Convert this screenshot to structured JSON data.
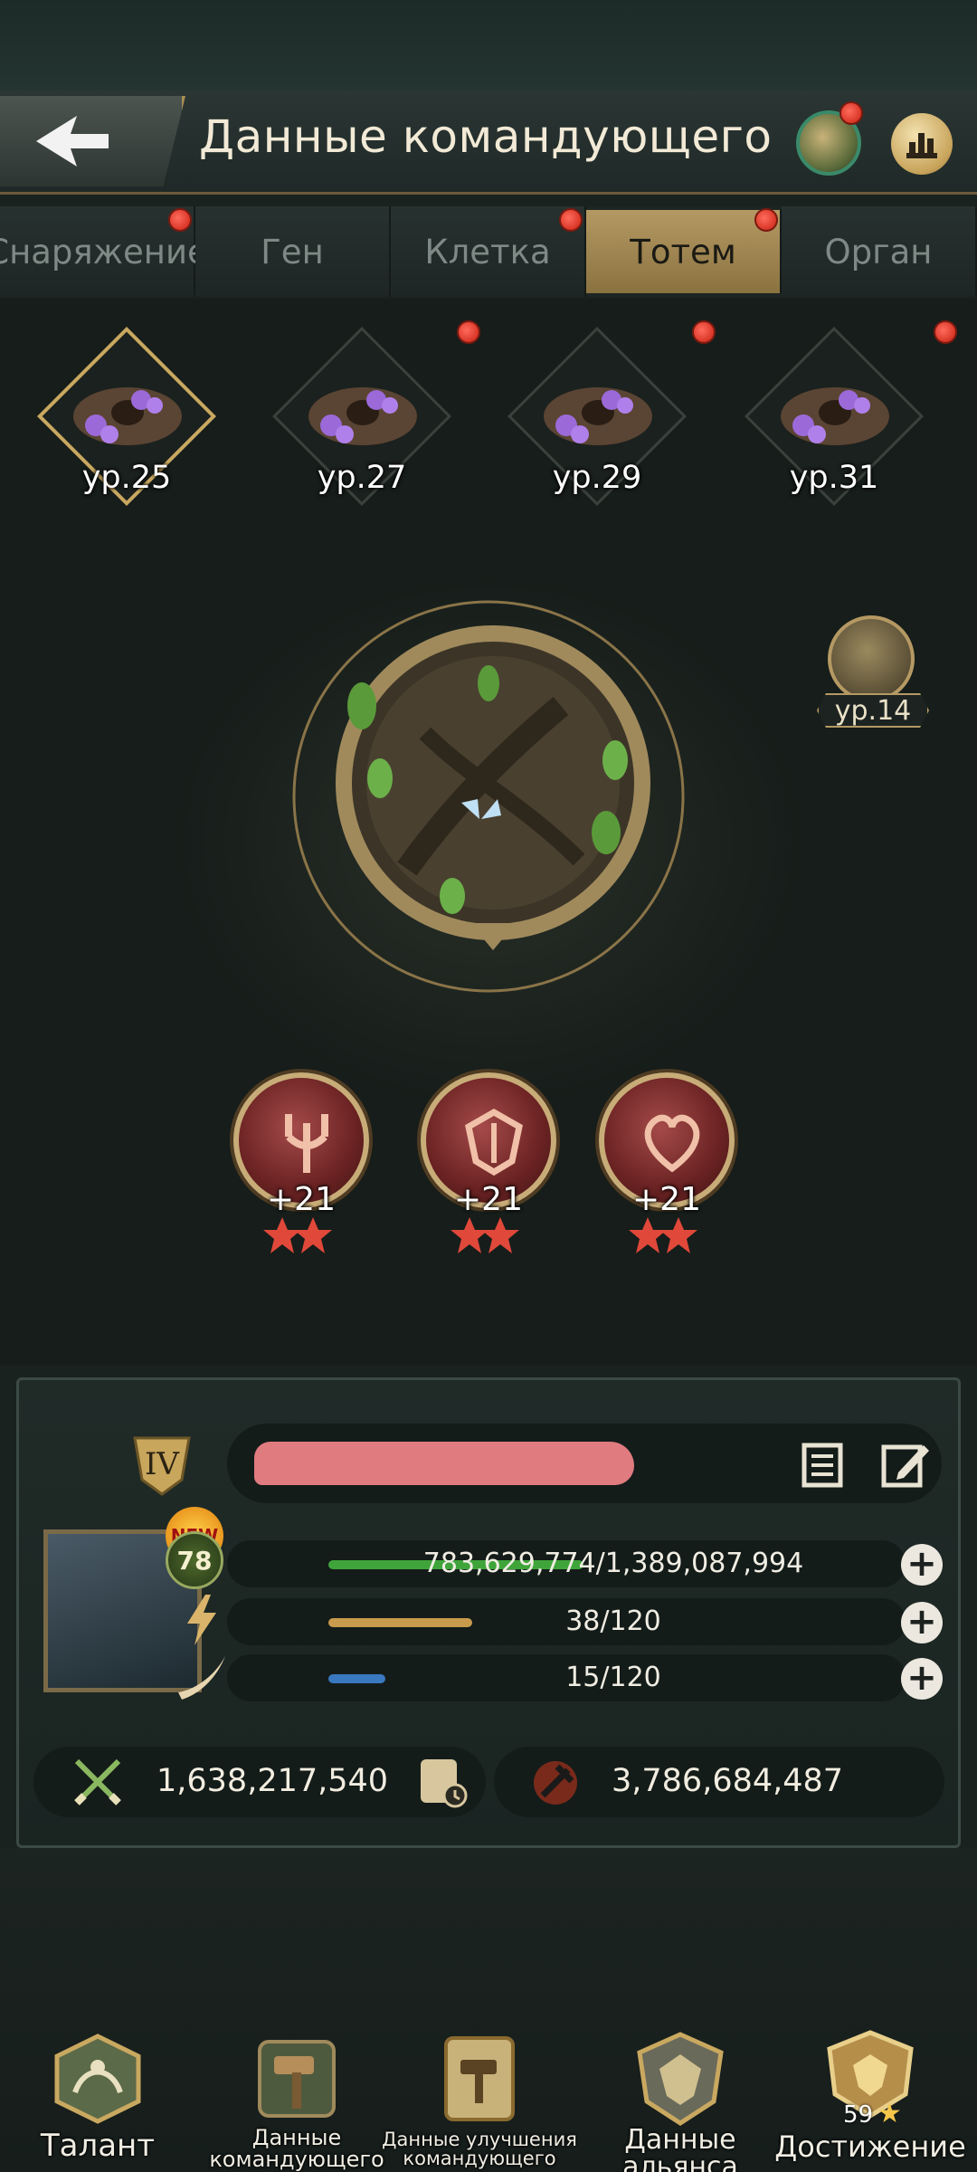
{
  "header": {
    "title": "Данные командующего",
    "back_icon": "back-arrow-icon",
    "icons": [
      "totem-shop-icon",
      "ranking-icon"
    ]
  },
  "tabs": [
    {
      "label": "Снаряжение",
      "active": false,
      "dot": true
    },
    {
      "label": "Ген",
      "active": false,
      "dot": false
    },
    {
      "label": "Клетка",
      "active": false,
      "dot": true
    },
    {
      "label": "Тотем",
      "active": true,
      "dot": true
    },
    {
      "label": "Орган",
      "active": false,
      "dot": false
    }
  ],
  "totem_slots": [
    {
      "level": "ур.25",
      "active": true,
      "dot": false
    },
    {
      "level": "ур.27",
      "active": false,
      "dot": true
    },
    {
      "level": "ур.29",
      "active": false,
      "dot": true
    },
    {
      "level": "ур.31",
      "active": false,
      "dot": true
    }
  ],
  "side_badge": {
    "level": "ур.14"
  },
  "runes": [
    {
      "bonus": "+21",
      "stars": 2,
      "icon": "attack-rune-icon"
    },
    {
      "bonus": "+21",
      "stars": 2,
      "icon": "defense-rune-icon"
    },
    {
      "bonus": "+21",
      "stars": 2,
      "icon": "health-rune-icon"
    }
  ],
  "profile": {
    "rank": "IV",
    "new_badge": "NEW",
    "level": "78",
    "stats": [
      {
        "text": "783,629,774/1,389,087,994",
        "fill": 0.564,
        "color": "#3fa53a"
      },
      {
        "text": "38/120",
        "fill": 0.317,
        "color": "#c89a4c"
      },
      {
        "text": "15/120",
        "fill": 0.125,
        "color": "#3a78c0"
      }
    ],
    "power": "1,638,217,540",
    "kills": "3,786,684,487"
  },
  "colors": {
    "accent": "#b59963",
    "dot": "#d8321f"
  },
  "bottom_nav": [
    {
      "label": "Талант"
    },
    {
      "label": "Данные командующего"
    },
    {
      "label": "Данные улучшения командующего"
    },
    {
      "label": "Данные альянса"
    },
    {
      "label": "Достижение",
      "badge": "59"
    }
  ]
}
